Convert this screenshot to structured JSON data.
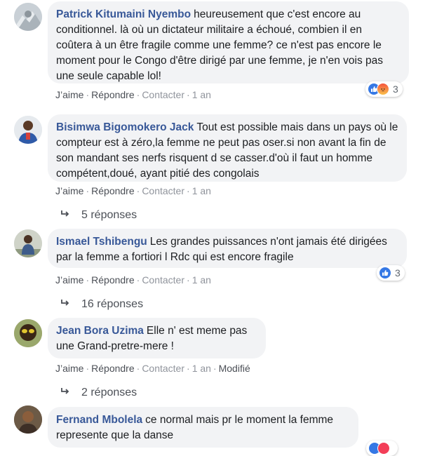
{
  "comments": [
    {
      "author": "Patrick Kitumaini Nyembo",
      "text": "heureusement que c'est encore au conditionnel. là où un dictateur militaire a échoué, combien il en coûtera à un être fragile comme une femme? ce n'est pas encore le moment pour le Congo d'être dirigé par une femme, je n'en vois pas une seule capable lol!",
      "actions": [
        "J’aime",
        "Répondre",
        "Contacter",
        "1 an"
      ],
      "reactions": {
        "types": [
          "like-icon",
          "angry-icon"
        ],
        "count": "3"
      }
    },
    {
      "author": "Bisimwa Bigomokero Jack",
      "text": "Tout est possible mais dans un pays où le compteur est à zéro,la femme ne peut pas oser.si non avant la fin de son mandant ses nerfs risquent d se casser.d'où il faut un homme compétent,doué, ayant pitié des congolais",
      "actions": [
        "J’aime",
        "Répondre",
        "Contacter",
        "1 an"
      ],
      "replies": "5 réponses"
    },
    {
      "author": "Ismael Tshibengu",
      "text": "Les grandes puissances n'ont jamais été dirigées par la femme a fortiori l Rdc qui est encore fragile",
      "actions": [
        "J’aime",
        "Répondre",
        "Contacter",
        "1 an"
      ],
      "reactions": {
        "types": [
          "like-icon"
        ],
        "count": "3"
      },
      "replies": "16 réponses"
    },
    {
      "author": "Jean Bora Uzima",
      "text": "Elle n' est meme pas une Grand-pretre-mere !",
      "actions": [
        "J’aime",
        "Répondre",
        "Contacter",
        "1 an",
        "Modifié"
      ],
      "replies": "2 réponses"
    },
    {
      "author": "Fernand Mbolela",
      "text": "ce normal mais pr le moment la femme represente que la danse",
      "reactions": {
        "types": [
          "like-icon",
          "love-icon"
        ],
        "count": ""
      }
    }
  ],
  "colors": {
    "author": "#385898",
    "bubble": "#f2f3f5",
    "meta": "#90949c",
    "like": "#3578e5"
  }
}
